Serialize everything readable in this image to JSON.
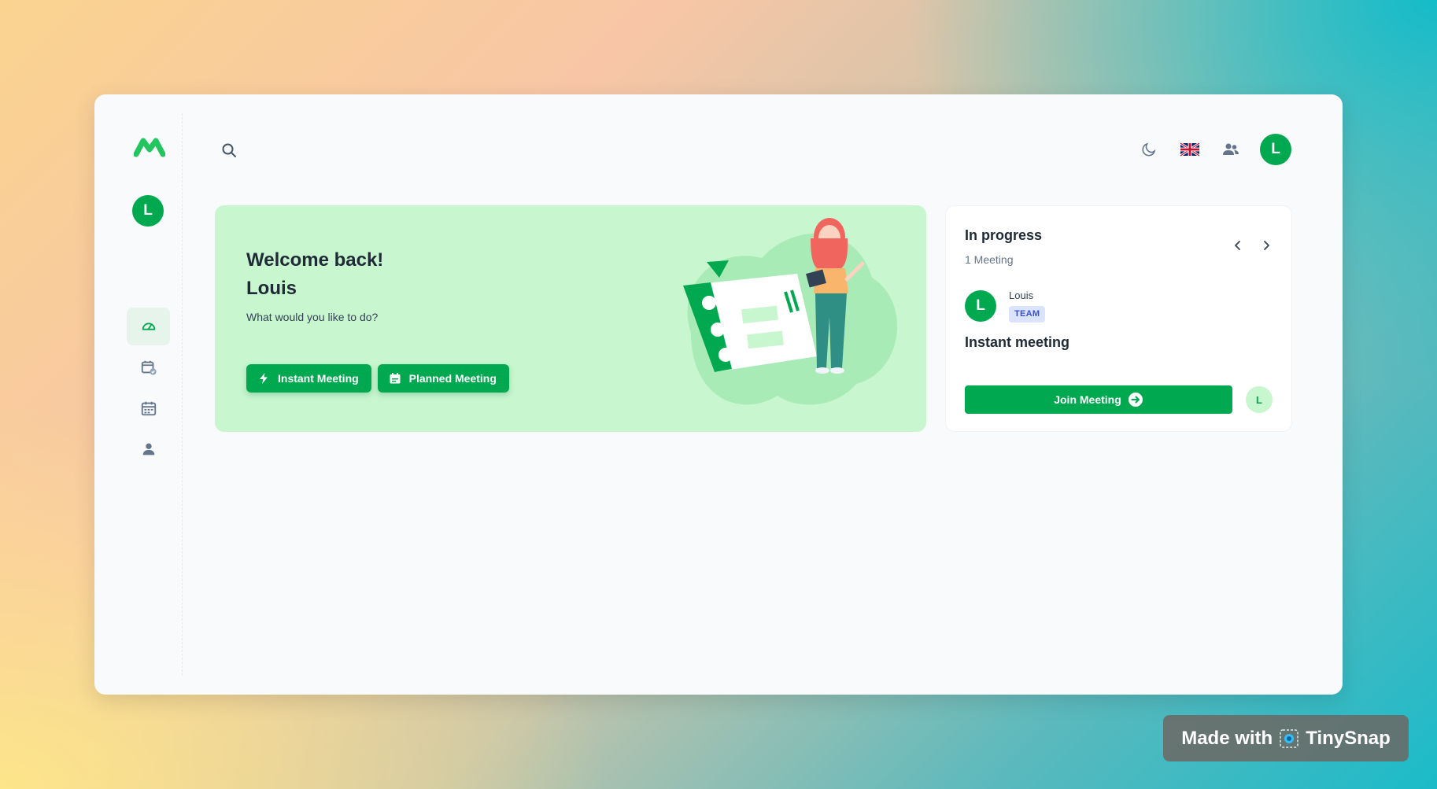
{
  "app": {
    "logo_icon": "m-logo-icon",
    "user_initial": "L"
  },
  "sidebar": {
    "items": [
      {
        "name": "dashboard",
        "icon": "dashboard-gauge-icon",
        "active": true
      },
      {
        "name": "scheduled",
        "icon": "calendar-check-icon",
        "active": false
      },
      {
        "name": "calendar",
        "icon": "calendar-grid-icon",
        "active": false
      },
      {
        "name": "profile",
        "icon": "user-icon",
        "active": false
      }
    ]
  },
  "topbar": {
    "search_icon": "search-icon",
    "theme_icon": "moon-icon",
    "language_icon": "uk-flag-icon",
    "contacts_icon": "users-icon",
    "user_initial": "L"
  },
  "welcome": {
    "title": "Welcome back!",
    "name": "Louis",
    "subtitle": "What would you like to do?",
    "instant_button": "Instant Meeting",
    "planned_button": "Planned Meeting"
  },
  "in_progress": {
    "title": "In progress",
    "count": "1 Meeting",
    "host_initial": "L",
    "host_name": "Louis",
    "badge": "TEAM",
    "meeting_title": "Instant meeting",
    "join_button": "Join Meeting",
    "participant_initial": "L"
  },
  "watermark": {
    "prefix": "Made with",
    "brand": "TinySnap"
  },
  "colors": {
    "accent": "#00a94f",
    "hero_bg": "#c8f7cf",
    "badge_bg": "#dbe4ff"
  }
}
